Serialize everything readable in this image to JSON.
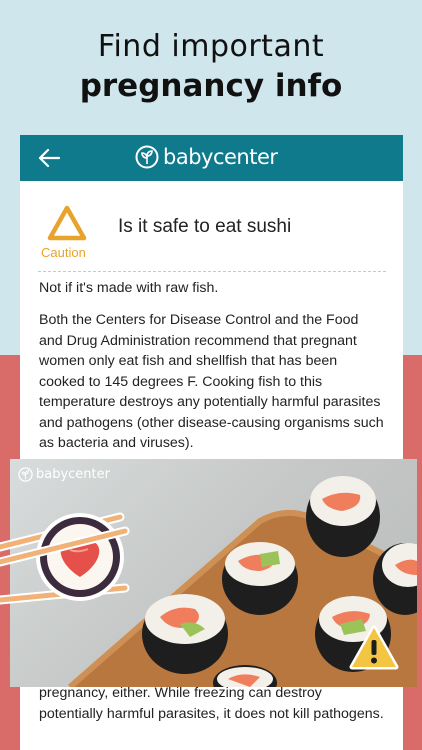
{
  "headline": {
    "line1": "Find important",
    "line2": "pregnancy info"
  },
  "app": {
    "brand": "babycenter"
  },
  "article": {
    "status_label": "Caution",
    "question": "Is it safe to eat sushi",
    "answer": "Not if it's made with raw fish.",
    "paragraph": "Both the Centers for Disease Control and the Food and Drug Administration recommend that pregnant women only eat fish and shellfish that has been cooked to 145 degrees F. Cooking fish to this temperature destroys any potentially harmful parasites and pathogens (other disease-causing organisms such as bacteria and viruses).",
    "paragraph_bottom": "pregnancy, either. While freezing can destroy potentially harmful parasites, it does not kill pathogens."
  },
  "photo": {
    "watermark": "babycenter"
  },
  "colors": {
    "accent": "#0f7a8c",
    "caution": "#e8a32c",
    "coral": "#d96b68",
    "sky": "#cfe6ec"
  }
}
